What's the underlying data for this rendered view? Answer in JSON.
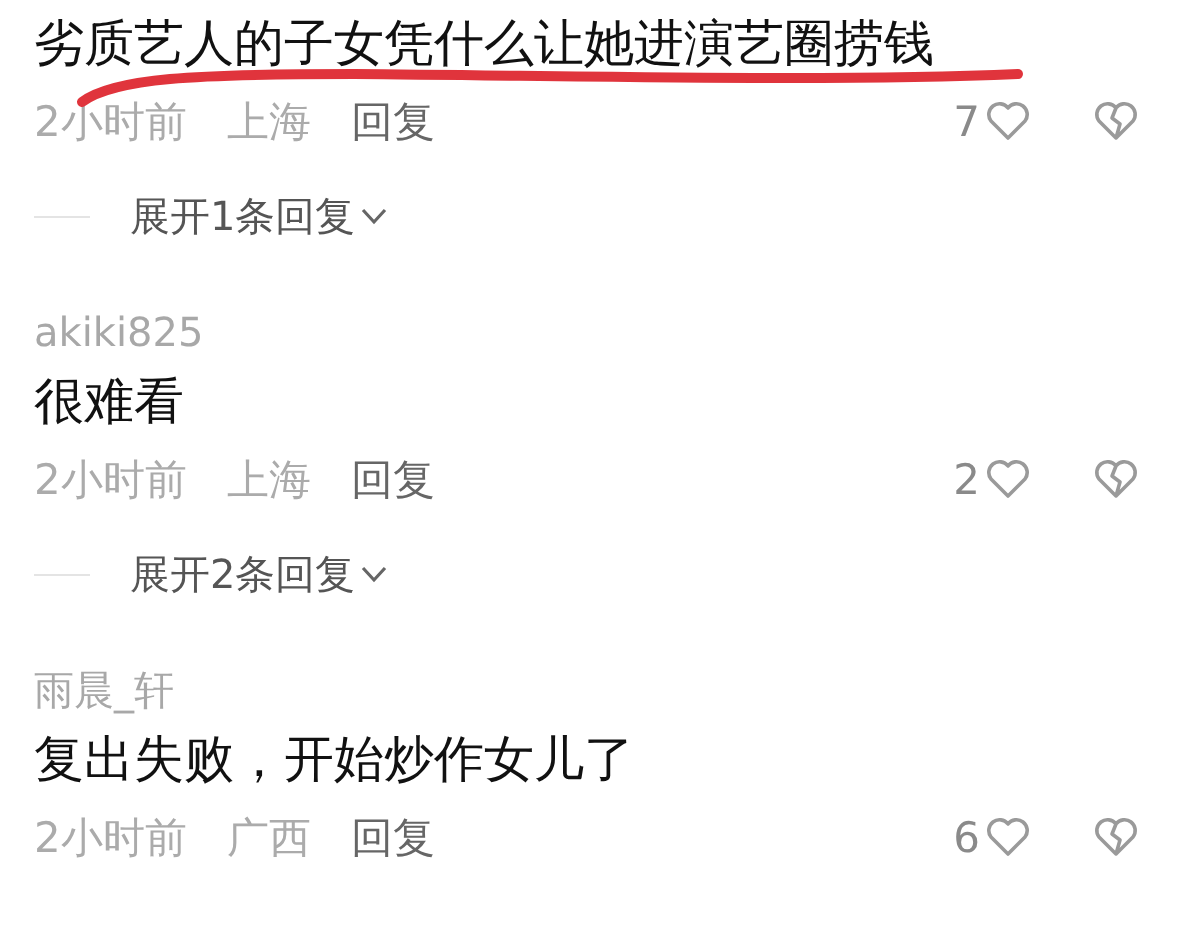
{
  "comments": [
    {
      "text": "劣质艺人的子女凭什么让她进演艺圈捞钱",
      "highlighted": true,
      "time": "2小时前",
      "location": "上海",
      "reply_label": "回复",
      "likes": "7",
      "replies_toggle": "展开1条回复"
    },
    {
      "username": "akiki825",
      "text": "很难看",
      "highlighted": false,
      "time": "2小时前",
      "location": "上海",
      "reply_label": "回复",
      "likes": "2",
      "replies_toggle": "展开2条回复"
    },
    {
      "username": "雨晨_轩",
      "text": "复出失败，开始炒作女儿了",
      "highlighted": false,
      "time": "2小时前",
      "location": "广西",
      "reply_label": "回复",
      "likes": "6"
    }
  ]
}
